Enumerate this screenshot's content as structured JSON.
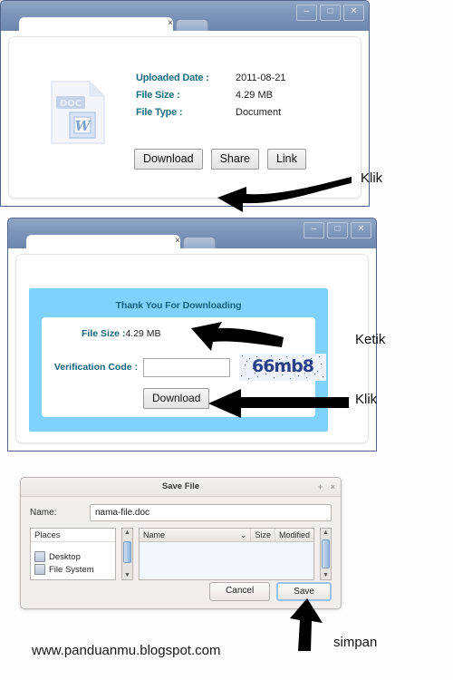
{
  "page": {
    "watermark": "www.panduanmu.blogspot.com"
  },
  "browser_chrome": {
    "minimize_label": "–",
    "maximize_label": "□",
    "close_label": "✕",
    "tab_close_label": "×"
  },
  "step1": {
    "file_icon_label": "DOC",
    "file_icon_glyph": "W",
    "rows": [
      {
        "label": "Uploaded Date :",
        "value": "2011-08-21"
      },
      {
        "label": "File Size :",
        "value": "4.29 MB"
      },
      {
        "label": "File Type :",
        "value": "Document"
      }
    ],
    "buttons": [
      {
        "label": "Download"
      },
      {
        "label": "Share"
      },
      {
        "label": "Link"
      }
    ],
    "annotation": "Klik"
  },
  "step2": {
    "heading": "Thank You For Downloading",
    "file_size_label": "File Size :",
    "file_size_value": "4.29 MB",
    "verification_label": "Verification Code :",
    "verification_value": "",
    "verification_placeholder": "",
    "captcha_text": "66mb8",
    "download_label": "Download",
    "annotation_type": "Ketik",
    "annotation_click": "Klik"
  },
  "step3": {
    "title": "Save File",
    "titlebar_buttons": {
      "expand": "+",
      "close": "×"
    },
    "name_label": "Name:",
    "name_value": "nama-file.doc",
    "places_header": "Places",
    "places_items": [
      {
        "label": "Desktop"
      },
      {
        "label": "File System"
      }
    ],
    "file_columns": [
      {
        "label": "Name"
      },
      {
        "label": "Size"
      },
      {
        "label": "Modified"
      }
    ],
    "sort_indicator": "⌄",
    "cancel_label": "Cancel",
    "save_label": "Save",
    "annotation": "simpan"
  },
  "colors": {
    "label_teal": "#12647a",
    "panel_blue": "#7ed2fb",
    "chrome_blue": "#7d95b8",
    "captcha_navy": "#2a3f86"
  }
}
